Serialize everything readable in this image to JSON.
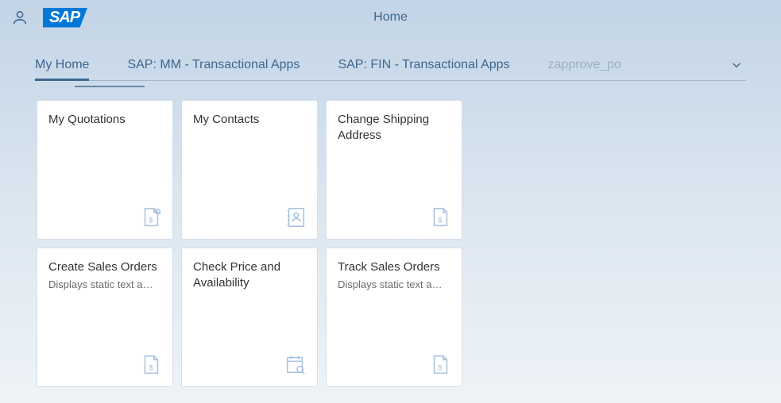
{
  "header": {
    "page_title": "Home",
    "logo_text": "SAP"
  },
  "tabs": [
    {
      "label": "My Home",
      "active": true
    },
    {
      "label": "SAP: MM - Transactional Apps",
      "active": false
    },
    {
      "label": "SAP: FIN - Transactional Apps",
      "active": false
    },
    {
      "label": "zapprove_po",
      "active": false,
      "faded": true
    }
  ],
  "tiles": [
    {
      "title": "My Quotations",
      "subtitle": "",
      "icon": "money-doc-search"
    },
    {
      "title": "My Contacts",
      "subtitle": "",
      "icon": "contact-book"
    },
    {
      "title": "Change Shipping Address",
      "subtitle": "",
      "icon": "money-doc"
    },
    {
      "title": "Create Sales Orders",
      "subtitle": "Displays static text a…",
      "icon": "money-doc"
    },
    {
      "title": "Check Price and Availability",
      "subtitle": "",
      "icon": "calendar-search"
    },
    {
      "title": "Track Sales Orders",
      "subtitle": "Displays static text a…",
      "icon": "money-doc"
    }
  ]
}
